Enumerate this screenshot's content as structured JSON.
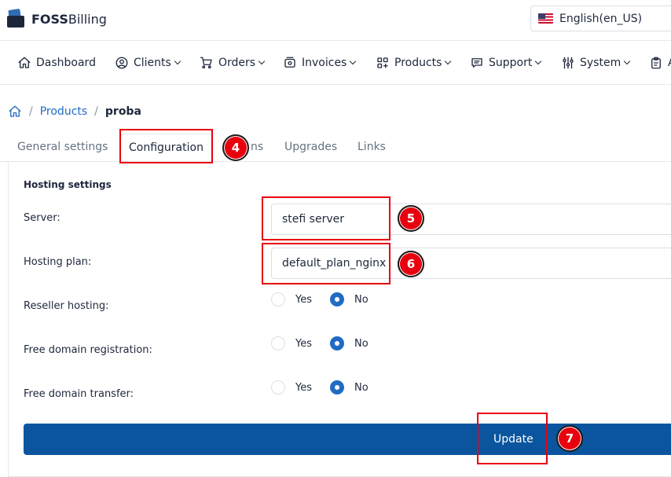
{
  "header": {
    "logo_bold": "FOSS",
    "logo_rest": "Billing",
    "language": "English(en_US)"
  },
  "nav": {
    "items": [
      {
        "label": "Dashboard",
        "icon": "home-icon",
        "has_caret": false
      },
      {
        "label": "Clients",
        "icon": "user-circle-icon",
        "has_caret": true
      },
      {
        "label": "Orders",
        "icon": "cart-icon",
        "has_caret": true
      },
      {
        "label": "Invoices",
        "icon": "invoice-icon",
        "has_caret": true
      },
      {
        "label": "Products",
        "icon": "grid-icon",
        "has_caret": true
      },
      {
        "label": "Support",
        "icon": "chat-icon",
        "has_caret": true
      },
      {
        "label": "System",
        "icon": "sliders-icon",
        "has_caret": true
      },
      {
        "label": "A",
        "icon": "clipboard-icon",
        "has_caret": false
      }
    ]
  },
  "breadcrumb": {
    "separator": "/",
    "parent": "Products",
    "current": "proba"
  },
  "tabs": {
    "general": "General settings",
    "configuration": "Configuration",
    "hidden_partial": "ns",
    "upgrades": "Upgrades",
    "links": "Links"
  },
  "form": {
    "section_title": "Hosting settings",
    "server_label": "Server:",
    "server_value": "stefi server",
    "plan_label": "Hosting plan:",
    "plan_value": "default_plan_nginx",
    "reseller_label": "Reseller hosting:",
    "free_reg_label": "Free domain registration:",
    "free_transfer_label": "Free domain transfer:",
    "yes": "Yes",
    "no": "No",
    "reseller_selected": "No",
    "free_reg_selected": "No",
    "free_transfer_selected": "No",
    "update_button": "Update"
  },
  "annotations": {
    "step4": "4",
    "step5": "5",
    "step6": "6",
    "step7": "7",
    "highlight_color": "#e8000f"
  },
  "colors": {
    "primary": "#206bc4",
    "button": "#0b559e",
    "text": "#1d273b"
  }
}
